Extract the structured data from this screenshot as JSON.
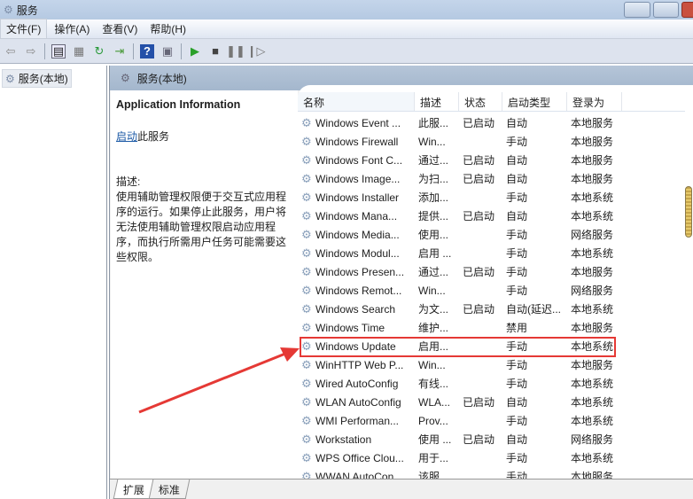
{
  "window": {
    "title": "服务"
  },
  "menu": [
    "文件(F)",
    "操作(A)",
    "查看(V)",
    "帮助(H)"
  ],
  "tree": {
    "root": "服务(本地)"
  },
  "panel": {
    "title": "服务(本地)"
  },
  "info": {
    "heading": "Application Information",
    "start_link": "启动",
    "start_suffix": "此服务",
    "desc_label": "描述:",
    "desc": "使用辅助管理权限便于交互式应用程序的运行。如果停止此服务，用户将无法使用辅助管理权限启动应用程序，而执行所需用户任务可能需要这些权限。"
  },
  "columns": [
    "名称",
    "描述",
    "状态",
    "启动类型",
    "登录为"
  ],
  "rows": [
    [
      "Windows Event ...",
      "此服...",
      "已启动",
      "自动",
      "本地服务"
    ],
    [
      "Windows Firewall",
      "Win...",
      "",
      "手动",
      "本地服务"
    ],
    [
      "Windows Font C...",
      "通过...",
      "已启动",
      "自动",
      "本地服务"
    ],
    [
      "Windows Image...",
      "为扫...",
      "已启动",
      "自动",
      "本地服务"
    ],
    [
      "Windows Installer",
      "添加...",
      "",
      "手动",
      "本地系统"
    ],
    [
      "Windows Mana...",
      "提供...",
      "已启动",
      "自动",
      "本地系统"
    ],
    [
      "Windows Media...",
      "使用...",
      "",
      "手动",
      "网络服务"
    ],
    [
      "Windows Modul...",
      "启用 ...",
      "",
      "手动",
      "本地系统"
    ],
    [
      "Windows Presen...",
      "通过...",
      "已启动",
      "手动",
      "本地服务"
    ],
    [
      "Windows Remot...",
      "Win...",
      "",
      "手动",
      "网络服务"
    ],
    [
      "Windows Search",
      "为文...",
      "已启动",
      "自动(延迟...",
      "本地系统"
    ],
    [
      "Windows Time",
      "维护...",
      "",
      "禁用",
      "本地服务"
    ],
    [
      "Windows Update",
      "启用...",
      "",
      "手动",
      "本地系统"
    ],
    [
      "WinHTTP Web P...",
      "Win...",
      "",
      "手动",
      "本地服务"
    ],
    [
      "Wired AutoConfig",
      "有线...",
      "",
      "手动",
      "本地系统"
    ],
    [
      "WLAN AutoConfig",
      "WLA...",
      "已启动",
      "自动",
      "本地系统"
    ],
    [
      "WMI Performan...",
      "Prov...",
      "",
      "手动",
      "本地系统"
    ],
    [
      "Workstation",
      "使用 ...",
      "已启动",
      "自动",
      "网络服务"
    ],
    [
      "WPS Office Clou...",
      "用于...",
      "",
      "手动",
      "本地系统"
    ],
    [
      "WWAN AutoCon...",
      "该服...",
      "",
      "手动",
      "本地服务"
    ]
  ],
  "highlighted_row": "Windows Update",
  "tabs": [
    "扩展",
    "标准"
  ],
  "colors": {
    "highlight": "#e53935",
    "link": "#1c5aa6"
  }
}
